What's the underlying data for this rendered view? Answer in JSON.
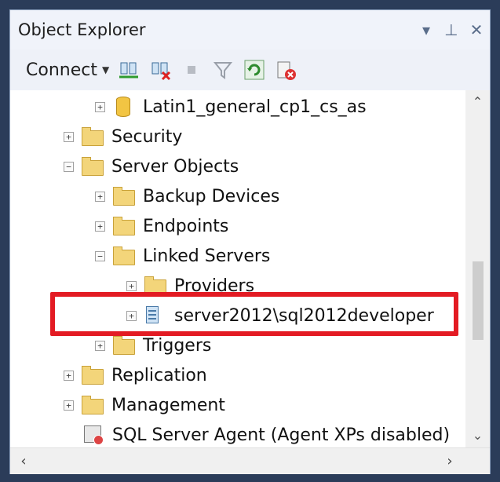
{
  "window": {
    "title": "Object Explorer",
    "controls": {
      "dropdown": "▾",
      "pin": "⊥",
      "close": "✕"
    }
  },
  "toolbar": {
    "connect_label": "Connect",
    "icons": [
      "connect-object-explorer-icon",
      "disconnect-icon",
      "stop-icon",
      "filter-icon",
      "refresh-icon",
      "start-powershell-icon"
    ]
  },
  "tree": {
    "nodes": [
      {
        "label": "Latin1_general_cp1_cs_as",
        "expander": "+",
        "icon": "database-icon"
      },
      {
        "label": "Security",
        "expander": "+",
        "icon": "folder-icon"
      },
      {
        "label": "Server Objects",
        "expander": "−",
        "icon": "folder-icon"
      },
      {
        "label": "Backup Devices",
        "expander": "+",
        "icon": "folder-icon"
      },
      {
        "label": "Endpoints",
        "expander": "+",
        "icon": "folder-icon"
      },
      {
        "label": "Linked Servers",
        "expander": "−",
        "icon": "folder-icon"
      },
      {
        "label": "Providers",
        "expander": "+",
        "icon": "folder-icon"
      },
      {
        "label": "server2012\\sql2012developer",
        "expander": "+",
        "icon": "linked-server-icon"
      },
      {
        "label": "Triggers",
        "expander": "+",
        "icon": "folder-icon"
      },
      {
        "label": "Replication",
        "expander": "+",
        "icon": "folder-icon"
      },
      {
        "label": "Management",
        "expander": "+",
        "icon": "folder-icon"
      },
      {
        "label": "SQL Server Agent (Agent XPs disabled)",
        "expander": "",
        "icon": "sql-agent-icon"
      }
    ]
  },
  "colors": {
    "highlight_border": "#e31b23",
    "window_frame": "#2b3c59",
    "titlebar_bg": "#f0f3fa"
  }
}
